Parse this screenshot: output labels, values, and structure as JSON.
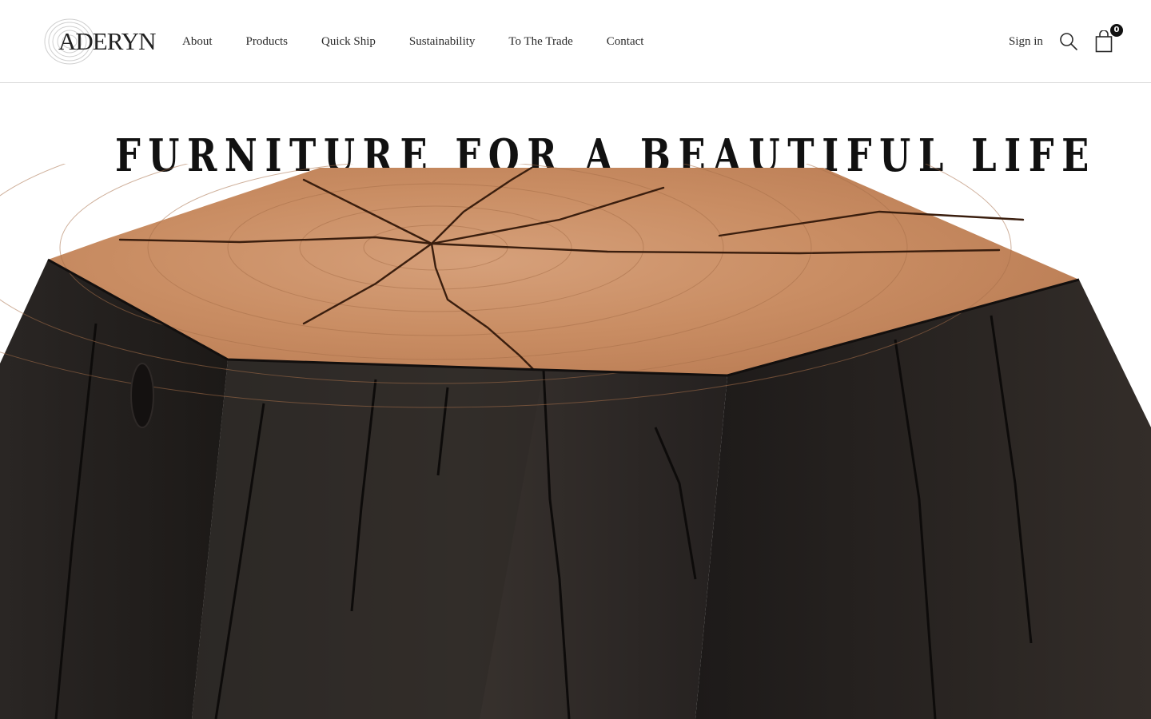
{
  "header": {
    "logo_text": "ADERYN",
    "nav": [
      {
        "label": "About"
      },
      {
        "label": "Products"
      },
      {
        "label": "Quick Ship"
      },
      {
        "label": "Sustainability"
      },
      {
        "label": "To The Trade"
      },
      {
        "label": "Contact"
      }
    ],
    "signin_label": "Sign in",
    "search_icon": "search-icon",
    "cart_icon": "shopping-bag-icon",
    "cart_count": "0"
  },
  "hero": {
    "title": "FURNITURE FOR A BEAUTIFUL LIFE",
    "image": "hexagonal-wood-stump-side-table"
  },
  "colors": {
    "background": "#ffffff",
    "text": "#111111",
    "wood_top": "#c48b62",
    "charred_body": "#1e1a18"
  }
}
